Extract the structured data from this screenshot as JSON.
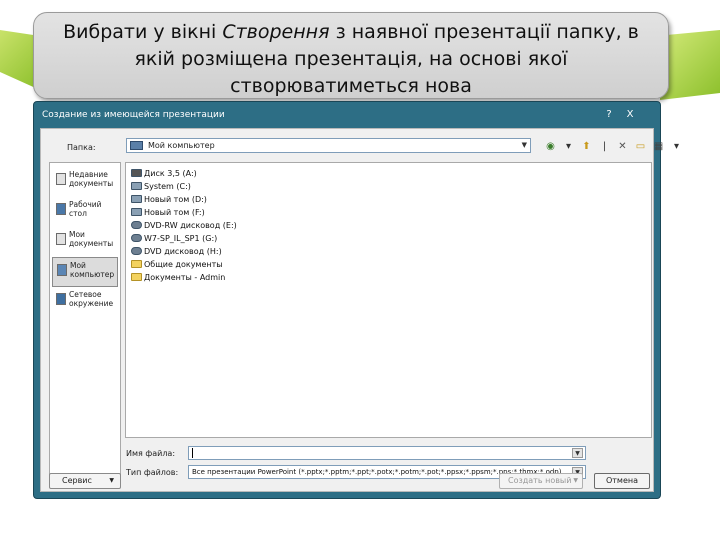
{
  "slide": {
    "title_part1": "Вибрати у вікні ",
    "title_italic": "Створення",
    "title_part2": " з наявної презентації папку, в",
    "title_line2": "якій розміщена презентація, на основі якої",
    "title_line3": "створюватиметься нова"
  },
  "dialog": {
    "title": "Создание из имеющейся презентации",
    "help_label": "?",
    "close_label": "X",
    "folder_label": "Папка:",
    "folder_value": "Мой компьютер",
    "places": [
      {
        "label": "Недавние документы"
      },
      {
        "label": "Рабочий стол"
      },
      {
        "label": "Мои документы"
      },
      {
        "label": "Мой компьютер"
      },
      {
        "label": "Сетевое окружение"
      }
    ],
    "files": [
      {
        "name": "Диск 3,5 (A:)",
        "icon": "floppy-icon"
      },
      {
        "name": "System (C:)",
        "icon": "drive-icon"
      },
      {
        "name": "Новый том (D:)",
        "icon": "drive-icon"
      },
      {
        "name": "Новый том (F:)",
        "icon": "drive-icon"
      },
      {
        "name": "DVD-RW дисковод (E:)",
        "icon": "dvd-icon"
      },
      {
        "name": "W7-SP_IL_SP1 (G:)",
        "icon": "dvd-icon"
      },
      {
        "name": "DVD дисковод (H:)",
        "icon": "dvd-icon"
      },
      {
        "name": "Общие документы",
        "icon": "folder-icon"
      },
      {
        "name": "Документы - Admin",
        "icon": "folder-icon"
      }
    ],
    "filename_label": "Имя файла:",
    "filename_value": "",
    "filetype_label": "Тип файлов:",
    "filetype_value": "Все презентации PowerPoint (*.pptx;*.pptm;*.ppt;*.potx;*.potm;*.pot;*.ppsx;*.ppsm;*.pps;*.thmx;*.odp)",
    "service_label": "Сервис",
    "create_label": "Создать новый",
    "cancel_label": "Отмена"
  }
}
